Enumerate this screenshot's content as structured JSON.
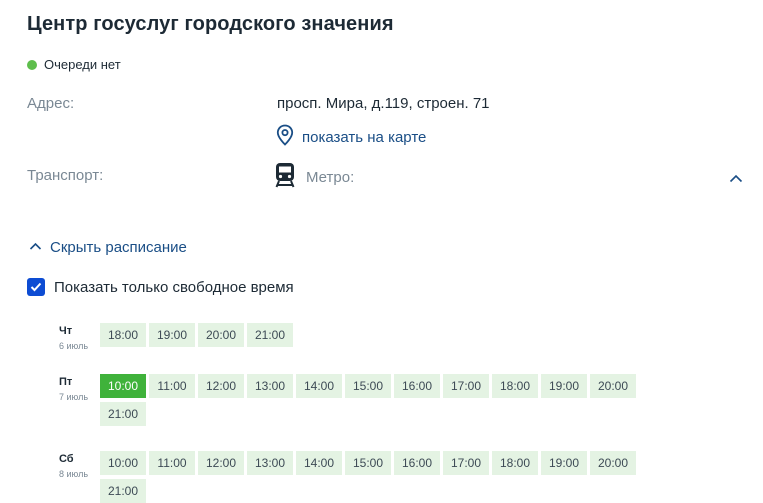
{
  "header": {
    "title": "Центр госуслуг городского значения"
  },
  "status": {
    "text": "Очереди нет",
    "color": "#5ebe4c"
  },
  "address": {
    "label": "Адрес:",
    "value": "просп. Мира, д.119, строен. 71",
    "map_link": "показать на карте"
  },
  "transport": {
    "label": "Транспорт:",
    "metro_label": "Метро:"
  },
  "schedule": {
    "toggle_label": "Скрыть расписание",
    "free_only_label": "Показать только свободное время",
    "free_only_checked": true,
    "days": [
      {
        "name": "Чт",
        "date": "6 июль",
        "slots": [
          "18:00",
          "19:00",
          "20:00",
          "21:00"
        ]
      },
      {
        "name": "Пт",
        "date": "7 июль",
        "selected": "10:00",
        "slots": [
          "10:00",
          "11:00",
          "12:00",
          "13:00",
          "14:00",
          "15:00",
          "16:00",
          "17:00",
          "18:00",
          "19:00",
          "20:00",
          "21:00"
        ]
      },
      {
        "name": "Сб",
        "date": "8 июль",
        "slots": [
          "10:00",
          "11:00",
          "12:00",
          "13:00",
          "14:00",
          "15:00",
          "16:00",
          "17:00",
          "18:00",
          "19:00",
          "20:00",
          "21:00"
        ]
      }
    ]
  },
  "colors": {
    "accent": "#0d4cd3",
    "link": "#1a4e86",
    "slot_bg": "#e4f3e3",
    "slot_selected": "#3fb23b"
  }
}
